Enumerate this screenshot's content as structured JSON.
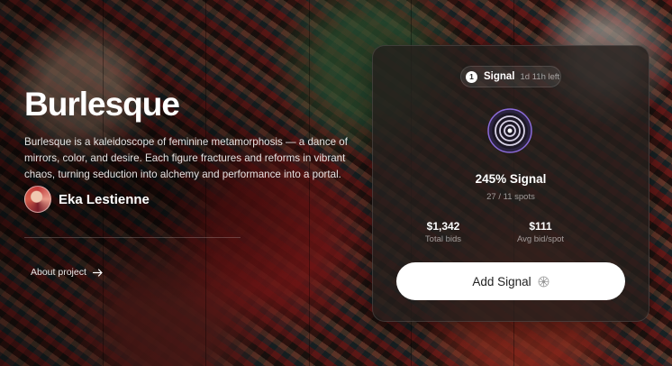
{
  "project": {
    "title": "Burlesque",
    "description": "Burlesque is a kaleidoscope of feminine metamorphosis — a dance of mirrors, color, and desire. Each figure fractures and reforms in vibrant chaos, turning seduction into alchemy and performance into a portal.",
    "artist_name": "Eka Lestienne",
    "about_link_label": "About project"
  },
  "signal_card": {
    "badge_number": "1",
    "pill_label": "Signal",
    "time_left": "1d 11h left",
    "signal_percent": "245% Signal",
    "spots": "27 / 11 spots",
    "stats": {
      "total_bids_value": "$1,342",
      "total_bids_label": "Total bids",
      "avg_bid_value": "$111",
      "avg_bid_label": "Avg bid/spot"
    },
    "add_button_label": "Add Signal"
  },
  "icons": {
    "about_arrow": "arrow-right-icon",
    "signal": "signal-rings-icon",
    "add_button": "spark-icon"
  },
  "colors": {
    "card_background": "#231e1c",
    "button_background": "#ffffff",
    "signal_ring_glow": "#8a6bd8"
  }
}
